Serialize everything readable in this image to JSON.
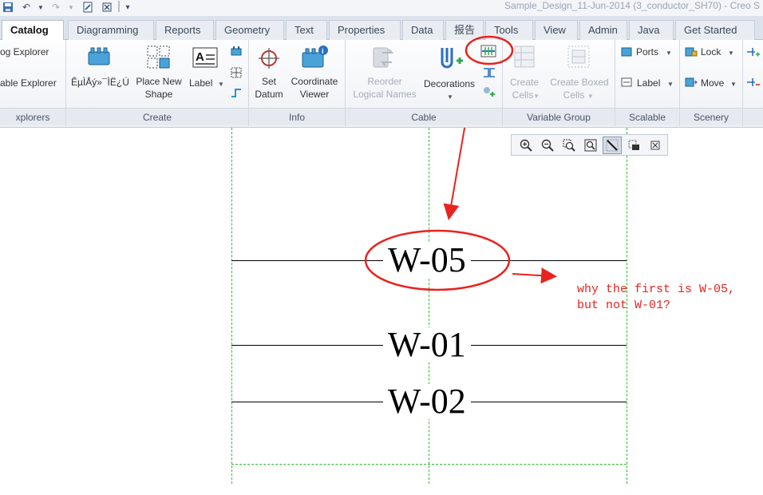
{
  "window": {
    "title": "Sample_Design_11-Jun-2014 (3_conductor_SH70) - Creo S"
  },
  "tabs": [
    {
      "label": "Catalog"
    },
    {
      "label": "Diagramming"
    },
    {
      "label": "Reports"
    },
    {
      "label": "Geometry"
    },
    {
      "label": "Text"
    },
    {
      "label": "Properties"
    },
    {
      "label": "Data"
    },
    {
      "label": "报告"
    },
    {
      "label": "Tools"
    },
    {
      "label": "View"
    },
    {
      "label": "Admin"
    },
    {
      "label": "Java"
    },
    {
      "label": "Get Started"
    }
  ],
  "ribbon": {
    "explorers": {
      "item1": "og Explorer",
      "item2": "able Explorer",
      "label": "xplorers"
    },
    "create": {
      "garbled": "ÊµÌÅý»¯ÌË¿Ú",
      "place_new_shape_1": "Place New",
      "place_new_shape_2": "Shape",
      "label_btn": "Label",
      "label": "Create"
    },
    "info": {
      "set_datum_1": "Set",
      "set_datum_2": "Datum",
      "coord_viewer_1": "Coordinate",
      "coord_viewer_2": "Viewer",
      "label": "Info"
    },
    "cable": {
      "reorder_1": "Reorder",
      "reorder_2": "Logical Names",
      "decorations": "Decorations",
      "label": "Cable"
    },
    "variable_group": {
      "create_cells_1": "Create",
      "create_cells_2": "Cells",
      "create_boxed_1": "Create Boxed",
      "create_boxed_2": "Cells",
      "label": "Variable Group"
    },
    "scalable": {
      "ports": "Ports",
      "label_btn": "Label",
      "label": "Scalable"
    },
    "scenery": {
      "lock": "Lock",
      "move": "Move",
      "label": "Scenery"
    }
  },
  "canvas": {
    "wires": [
      {
        "label": "W-05"
      },
      {
        "label": "W-01"
      },
      {
        "label": "W-02"
      }
    ],
    "annotation_line1": "why the first is W-05,",
    "annotation_line2": "but not W-01?"
  },
  "colors": {
    "annotation": "#e8231e",
    "guide": "#2ebd2e",
    "accent": "#2b6fc4"
  }
}
